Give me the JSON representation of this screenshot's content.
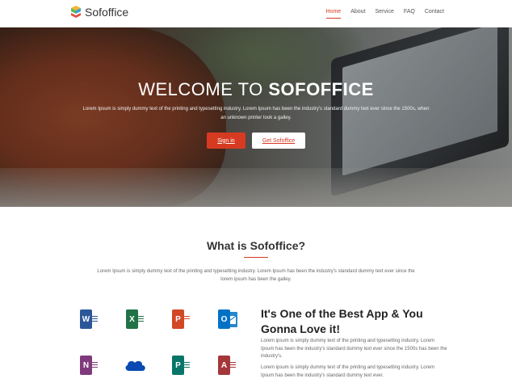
{
  "header": {
    "logo_text": "Sofoffice",
    "nav": [
      {
        "label": "Home",
        "active": true
      },
      {
        "label": "About",
        "active": false
      },
      {
        "label": "Service",
        "active": false
      },
      {
        "label": "FAQ",
        "active": false
      },
      {
        "label": "Contact",
        "active": false
      }
    ]
  },
  "hero": {
    "title_prefix": "WELCOME TO ",
    "title_brand": "SOFOFFICE",
    "text": "Lorem Ipsum is simply dummy text of the printing and typesetting industry. Lorem Ipsum has been the industry's standard dummy text ever since the 1500s, when an unknown printer took a galley.",
    "signin_label": "Sign in",
    "get_label": "Get Sofoffice"
  },
  "what": {
    "title": "What is Sofoffice?",
    "text": "Lorem Ipsum is simply dummy text of the printing and typesetting industry. Lorem Ipsum has been the industry's standard dummy text ever since the lorem ipsum has been the galley."
  },
  "apps": [
    {
      "name": "word-icon",
      "letter": "W",
      "color": "#2b579a"
    },
    {
      "name": "excel-icon",
      "letter": "X",
      "color": "#217346"
    },
    {
      "name": "powerpoint-icon",
      "letter": "P",
      "color": "#d24726"
    },
    {
      "name": "outlook-icon",
      "letter": "O",
      "color": "#0072c6"
    },
    {
      "name": "onenote-icon",
      "letter": "N",
      "color": "#80397b"
    },
    {
      "name": "onedrive-icon",
      "letter": "",
      "color": "#094ab2"
    },
    {
      "name": "publisher-icon",
      "letter": "P",
      "color": "#077568"
    },
    {
      "name": "access-icon",
      "letter": "A",
      "color": "#a4373a"
    }
  ],
  "feature": {
    "title": "It's One of the Best App & You Gonna Love it!",
    "p1": "Lorem ipsum is simply dummy text of the printing and typesetting industry. Lorem Ipsum has been the industry's standard dummy text ever since the 1500s has been the industry's.",
    "p2": "Lorem ipsum is simply dummy text of the printing and typesetting industry. Lorem Ipsum has been the industry's standard dummy text ever."
  },
  "colors": {
    "accent": "#d63b22"
  }
}
